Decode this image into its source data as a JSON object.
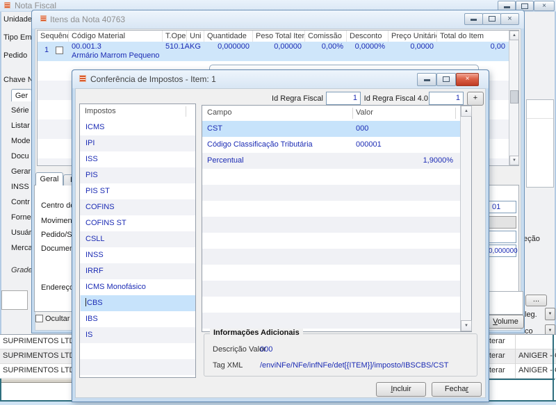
{
  "nota_fiscal": {
    "title": "Nota Fiscal",
    "field_labels": [
      "Unidade",
      "Tipo Emis",
      "Pedido",
      "Chave N"
    ],
    "tab_label": "Ger",
    "side_labels": [
      "Série",
      "Listar",
      "Mode",
      "Docu",
      "Gerar",
      "INSS",
      "Contr",
      "Forne",
      "Usuár",
      "Merca"
    ],
    "grade_label": "Grade",
    "right_panel": {
      "clipped_label": "eção",
      "browse_label": "...",
      "dropdown1": "leg.",
      "dropdown2": "co"
    },
    "bottom_grid": {
      "rows": [
        {
          "left": "SUPRIMENTOS LTDA",
          "mid": "terar",
          "right": ""
        },
        {
          "left": "SUPRIMENTOS LTDA",
          "mid": "terar",
          "right": "ANIGER - CAL"
        },
        {
          "left": "SUPRIMENTOS LTDA",
          "mid": "terar",
          "right": "ANIGER - CAL"
        }
      ]
    }
  },
  "itens_window": {
    "title": "Itens da Nota 40763",
    "table": {
      "headers": [
        "Sequência",
        "Código Material",
        "T.Oper.",
        "Uni",
        "Quantidade",
        "Peso Total Item",
        "Comissão",
        "Desconto",
        "Preço Unitário",
        "Total do Item"
      ],
      "row": {
        "sequencia": "1",
        "codigo": "00.001.3",
        "descricao": "Armário Marrom Pequeno",
        "t_oper": "510.1A",
        "uni": "KG",
        "quantidade": "0,000000",
        "peso_total": "0,00000",
        "comissao": "0,00%",
        "desconto": "0,0000%",
        "preco_unitario": "0,0000",
        "total": "0,00"
      }
    },
    "tabs": {
      "geral": "Geral",
      "imp": "Imp"
    },
    "field_labels": [
      "Centro de",
      "Moviment",
      "Pedido/Se",
      "Document",
      "Endereço"
    ],
    "right_fields": {
      "value1": "01",
      "value2": "0,000000"
    },
    "ocultar_label": "Ocultar de",
    "volume_button": {
      "pre": "",
      "key": "V",
      "post": "olume"
    }
  },
  "conferencia": {
    "title": "Conferência de Impostos - Item: 1",
    "id_regra_fiscal": {
      "label": "Id Regra Fiscal",
      "value": "1"
    },
    "id_regra_fiscal_40": {
      "label": "Id Regra Fiscal 4.0",
      "value": "1"
    },
    "add_rule_button": "+",
    "impostos": {
      "header": "Impostos",
      "items": [
        "ICMS",
        "IPI",
        "ISS",
        "PIS",
        "PIS ST",
        "COFINS",
        "COFINS ST",
        "CSLL",
        "INSS",
        "IRRF",
        "ICMS Monofásico",
        "CBS",
        "IBS",
        "IS"
      ],
      "selected": "CBS"
    },
    "campos": {
      "col_campo": "Campo",
      "col_valor": "Valor",
      "rows": [
        {
          "campo": "CST",
          "valor": "000"
        },
        {
          "campo": "Código Classificação Tributária",
          "valor": "000001"
        },
        {
          "campo": "Percentual",
          "valor": "1,9000%"
        }
      ]
    },
    "informacoes": {
      "title": "Informações Adicionais",
      "descricao_label": "Descrição Valor",
      "descricao_valor": "000",
      "tag_label": "Tag XML",
      "tag_valor": "/enviNFe/NFe/infNFe/det[{ITEM}]/imposto/IBSCBS/CST"
    },
    "incluir_button": {
      "pre": "",
      "key": "I",
      "post": "ncluir"
    },
    "fechar_button": {
      "pre": "Fecha",
      "key": "r",
      "post": ""
    }
  },
  "icons": {
    "close": "×",
    "scroll_up": "▲",
    "scroll_down": "▼",
    "dropdown": "▼",
    "plus": "+",
    "ellipsis": "..."
  },
  "colors": {
    "selection": "#c7e3fb",
    "data_text": "#1b2bb4",
    "teal_line": "#2e6e7e",
    "close_red": "#c23f28"
  }
}
